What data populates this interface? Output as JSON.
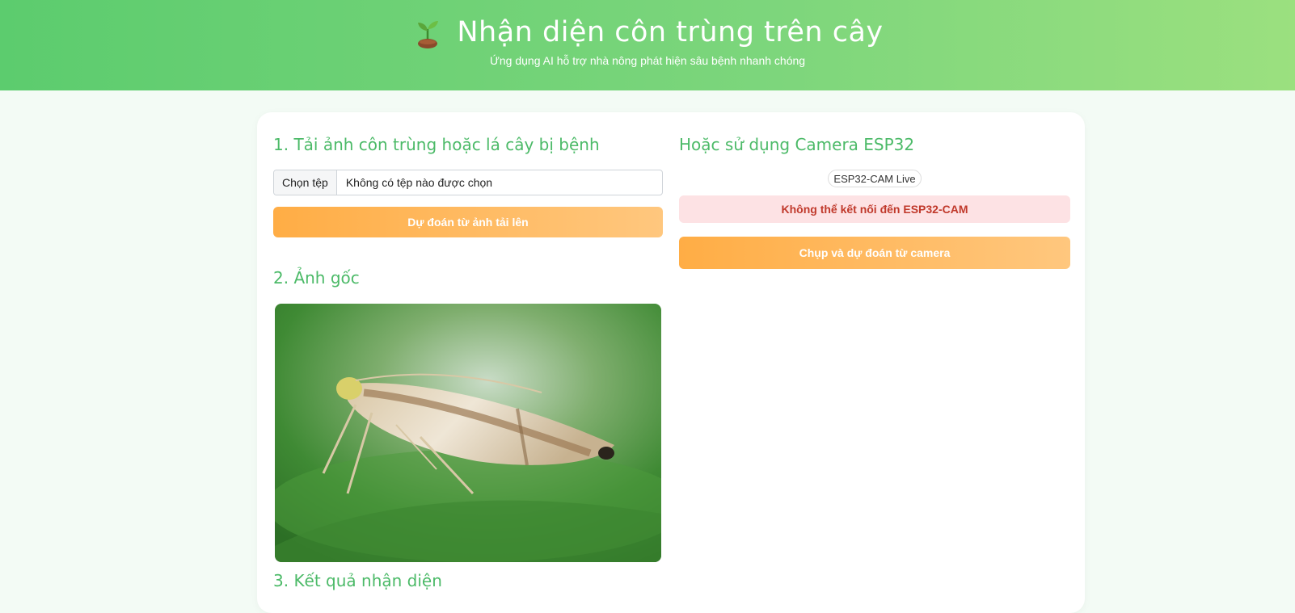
{
  "header": {
    "title": "Nhận diện côn trùng trên cây",
    "subtitle": "Ứng dụng AI hỗ trợ nhà nông phát hiện sâu bệnh nhanh chóng",
    "icon": "sprout-icon"
  },
  "upload": {
    "heading": "1. Tải ảnh côn trùng hoặc lá cây bị bệnh",
    "file_button": "Chọn tệp",
    "file_status": "Không có tệp nào được chọn",
    "predict_button": "Dự đoán từ ảnh tải lên"
  },
  "original": {
    "heading": "2. Ảnh gốc",
    "image": "insect-photo"
  },
  "result": {
    "heading": "3. Kết quả nhận diện"
  },
  "camera": {
    "heading": "Hoặc sử dụng Camera ESP32",
    "live_alt": "ESP32-CAM Live",
    "error": "Không thể kết nối đến ESP32-CAM",
    "capture_button": "Chụp và dự đoán từ camera"
  },
  "colors": {
    "header_start": "#5ccc6e",
    "header_end": "#9be07f",
    "heading": "#4cba68",
    "button_start": "#ffad45",
    "button_end": "#ffc77e",
    "error_bg": "#fde2e4",
    "error_text": "#c0392b"
  }
}
